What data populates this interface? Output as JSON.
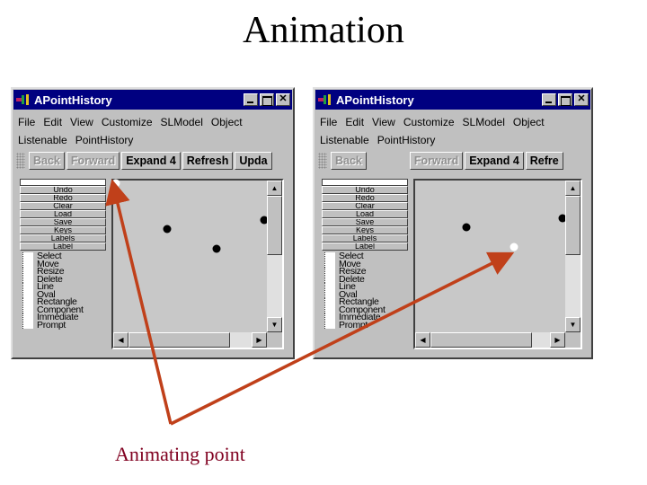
{
  "slide": {
    "title": "Animation",
    "caption": "Animating point",
    "accent_color": "#c0401a",
    "caption_color": "#800020"
  },
  "windows": [
    {
      "id": "before",
      "title": "APointHistory",
      "menu_row1": [
        "File",
        "Edit",
        "View",
        "Customize",
        "SLModel",
        "Object"
      ],
      "menu_row2": [
        "Listenable",
        "PointHistory"
      ],
      "toolbar": [
        {
          "label": "Back",
          "enabled": false
        },
        {
          "label": "Forward",
          "enabled": false
        },
        {
          "label": "Expand 4",
          "enabled": true
        },
        {
          "label": "Refresh",
          "enabled": true
        },
        {
          "label": "Upda",
          "enabled": true
        }
      ],
      "commands": [
        "Undo",
        "Redo",
        "Clear",
        "Load",
        "Save",
        "Keys",
        "Labels",
        "Label"
      ],
      "modes": [
        "Select",
        "Move",
        "Resize",
        "Delete",
        "Line",
        "Oval",
        "Rectangle",
        "Component",
        "Immediate",
        "Prompt"
      ],
      "points": [
        {
          "x": 0.02,
          "y": 0.02,
          "animating": true
        },
        {
          "x": 0.35,
          "y": 0.32,
          "animating": false
        },
        {
          "x": 0.67,
          "y": 0.45,
          "animating": false
        },
        {
          "x": 0.98,
          "y": 0.26,
          "animating": false
        }
      ],
      "scroll": {
        "vertical": 0.0,
        "horizontal": 0.0
      }
    },
    {
      "id": "after",
      "title": "APointHistory",
      "menu_row1": [
        "File",
        "Edit",
        "View",
        "Customize",
        "SLModel",
        "Object"
      ],
      "menu_row2": [
        "Listenable",
        "PointHistory"
      ],
      "toolbar": [
        {
          "label": "Back",
          "enabled": false
        },
        {
          "label": "Forward",
          "enabled": false
        },
        {
          "label": "Expand 4",
          "enabled": true
        },
        {
          "label": "Refre",
          "enabled": true
        }
      ],
      "commands": [
        "Undo",
        "Redo",
        "Clear",
        "Load",
        "Save",
        "Keys",
        "Labels",
        "Label"
      ],
      "modes": [
        "Select",
        "Move",
        "Resize",
        "Delete",
        "Line",
        "Oval",
        "Rectangle",
        "Component",
        "Immediate",
        "Prompt"
      ],
      "points": [
        {
          "x": 0.34,
          "y": 0.31,
          "animating": false
        },
        {
          "x": 0.66,
          "y": 0.44,
          "animating": true
        },
        {
          "x": 0.98,
          "y": 0.25,
          "animating": false
        }
      ],
      "scroll": {
        "vertical": 0.0,
        "horizontal": 0.0
      }
    }
  ]
}
